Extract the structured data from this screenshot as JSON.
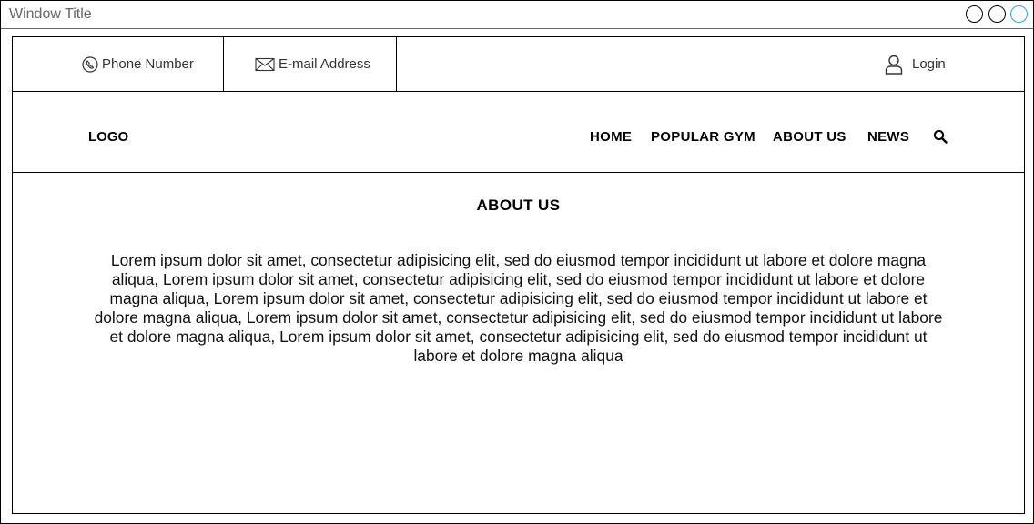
{
  "window": {
    "title": "Window Title"
  },
  "topbar": {
    "phone_label": "Phone Number",
    "email_label": "E-mail Address",
    "login_label": "Login",
    "icons": {
      "phone": "phone-icon",
      "email": "envelope-icon",
      "login": "user-icon"
    }
  },
  "navbar": {
    "logo": "LOGO",
    "items": [
      {
        "label": "HOME"
      },
      {
        "label": "POPULAR GYM"
      },
      {
        "label": "ABOUT US"
      },
      {
        "label": "NEWS"
      }
    ],
    "search_icon": "search-icon"
  },
  "main": {
    "title": "ABOUT US",
    "body": "Lorem ipsum dolor sit amet, consectetur adipisicing elit, sed do eiusmod tempor incididunt ut labore et dolore magna aliqua, Lorem ipsum dolor sit amet, consectetur adipisicing elit, sed do eiusmod tempor incididunt ut labore et dolore magna aliqua, Lorem ipsum dolor sit amet, consectetur adipisicing elit, sed do eiusmod tempor incididunt ut labore et dolore magna aliqua, Lorem ipsum dolor sit amet, consectetur adipisicing elit, sed do eiusmod tempor incididunt ut labore et dolore magna aliqua, Lorem ipsum dolor sit amet, consectetur adipisicing elit, sed do eiusmod tempor incididunt ut labore et dolore magna aliqua"
  },
  "colors": {
    "border": "#000000",
    "title_text": "#666666",
    "active_window_button": "#29a3e6"
  }
}
